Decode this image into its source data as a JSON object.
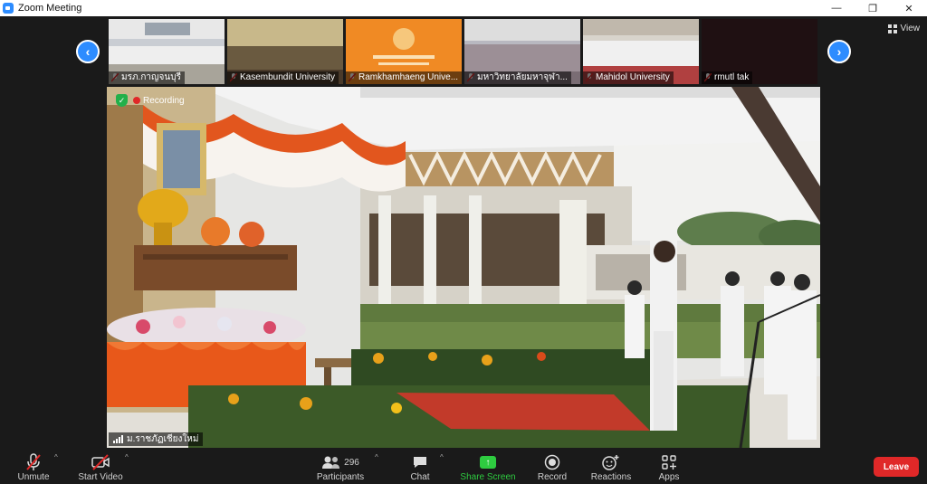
{
  "window": {
    "title": "Zoom Meeting",
    "minimize": "—",
    "restore": "❐",
    "close": "✕"
  },
  "view_button": {
    "label": "View"
  },
  "thumbnails": [
    {
      "name": "มรภ.กาญจนบุรี"
    },
    {
      "name": "Kasembundit University"
    },
    {
      "name": "Ramkhamhaeng Unive..."
    },
    {
      "name": "มหาวิทยาลัยมหาจุฬา..."
    },
    {
      "name": "Mahidol University"
    },
    {
      "name": "rmutl tak"
    }
  ],
  "main_video": {
    "recording_label": "Recording",
    "speaker_name": "ม.ราชภัฏเชียงใหม่"
  },
  "toolbar": {
    "unmute": "Unmute",
    "start_video": "Start Video",
    "participants": "Participants",
    "participants_count": "296",
    "chat": "Chat",
    "share_screen": "Share Screen",
    "record": "Record",
    "reactions": "Reactions",
    "apps": "Apps",
    "leave": "Leave"
  },
  "colors": {
    "accent": "#2d8cff",
    "leave": "#e02828",
    "share": "#2ecc40",
    "record": "#e02828"
  }
}
